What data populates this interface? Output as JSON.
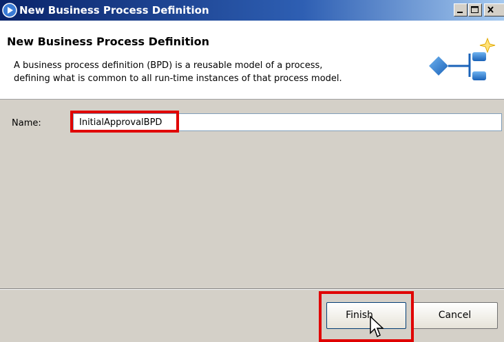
{
  "window": {
    "title": "New Business Process Definition",
    "controls": {
      "minimize": "minimize",
      "maximize": "maximize",
      "close": "close"
    }
  },
  "header": {
    "title": "New Business Process Definition",
    "description_lines": [
      "A business process definition (BPD) is a reusable model of a process,",
      "defining what is common to all run-time instances of that process model."
    ],
    "art_icon": "bpd-wizard-icon"
  },
  "form": {
    "name_label": "Name:",
    "name_value": "InitialApprovalBPD"
  },
  "buttons": {
    "finish": "Finish",
    "cancel": "Cancel"
  },
  "colors": {
    "highlight": "#e00000",
    "titlebar_start": "#0a246a",
    "titlebar_end": "#a6caf0",
    "dialog_bg": "#d4d0c8"
  }
}
